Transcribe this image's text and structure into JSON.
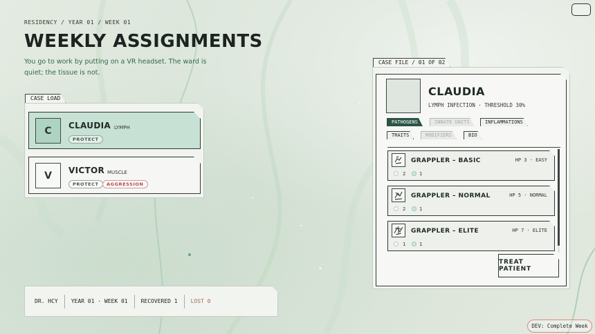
{
  "header": {
    "breadcrumb": "RESIDENCY / YEAR 01 / WEEK 01",
    "title": "WEEKLY ASSIGNMENTS",
    "intro": "You go to work by putting on a VR headset. The ward is quiet; the tissue is not."
  },
  "caseload": {
    "label": "CASE LOAD",
    "cases": [
      {
        "initial": "C",
        "name": "CLAUDIA",
        "tissue": "LYMPH",
        "badges": [
          "PROTECT"
        ]
      },
      {
        "initial": "V",
        "name": "VICTOR",
        "tissue": "MUSCLE",
        "badges": [
          "PROTECT",
          "AGGRESSION"
        ]
      }
    ]
  },
  "status": {
    "doctor": "DR. HCY",
    "date": "YEAR 01 · WEEK 01",
    "recovered": "RECOVERED 1",
    "lost": "LOST 0"
  },
  "casefile": {
    "label": "CASE FILE / 01 OF 02",
    "name": "CLAUDIA",
    "subtitle": "LYMPH INFECTION · THRESHOLD 30%",
    "tabs_row1": [
      "PATHOGENS",
      "INNATE UNITS",
      "INFLAMMATIONS"
    ],
    "tabs_row2": [
      "TRAITS",
      "MODIFIERS",
      "BIO"
    ],
    "pathogens": [
      {
        "name": "GRAPPLER – BASIC",
        "stat": "HP 3 · EASY",
        "count_a": "2",
        "count_b": "1"
      },
      {
        "name": "GRAPPLER – NORMAL",
        "stat": "HP 5 · NORMAL",
        "count_a": "2",
        "count_b": "1"
      },
      {
        "name": "GRAPPLER – ELITE",
        "stat": "HP 7 · ELITE",
        "count_a": "1",
        "count_b": "1"
      }
    ],
    "treat_label": "TREAT PATIENT"
  },
  "dev_button": "DEV: Complete Week",
  "icons": {
    "menu": "menu-icon",
    "pathogen": "grappler-icon"
  },
  "colors": {
    "accent": "#2b5447",
    "active_card": "#c7e1d5",
    "aggression": "#b04848",
    "dev_outline": "#d98a7e"
  }
}
